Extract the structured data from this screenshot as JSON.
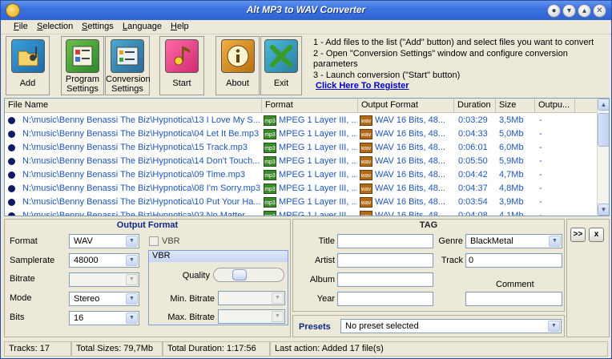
{
  "window": {
    "title": "Alt MP3 to WAV Converter"
  },
  "menu": [
    {
      "label": "File",
      "u": "F",
      "rest": "ile"
    },
    {
      "label": "Selection",
      "u": "S",
      "rest": "election"
    },
    {
      "label": "Settings",
      "u": "S",
      "rest": "ettings"
    },
    {
      "label": "Language",
      "u": "L",
      "rest": "anguage"
    },
    {
      "label": "Help",
      "u": "H",
      "rest": "elp"
    }
  ],
  "toolbar": {
    "add": "Add",
    "program_settings_1": "Program",
    "program_settings_2": "Settings",
    "conversion_settings_1": "Conversion",
    "conversion_settings_2": "Settings",
    "start": "Start",
    "about": "About",
    "exit": "Exit"
  },
  "instructions": {
    "line1": "1 - Add files to the list (\"Add\" button) and select files you want to convert",
    "line2": "2 - Open \"Conversion Settings\" window and configure conversion parameters",
    "line3": "3 - Launch conversion (\"Start\" button)",
    "register": "Click Here To Register"
  },
  "filelist": {
    "columns": [
      "File Name",
      "Format",
      "Output Format",
      "Duration",
      "Size",
      "Outpu..."
    ],
    "rows": [
      {
        "name": "N:\\music\\Benny Benassi The Biz\\Hypnotica\\13 I Love My S...",
        "format": "MPEG 1 Layer III, ...",
        "output": "WAV 16 Bits, 48...",
        "duration": "0:03:29",
        "size": "3,5Mb",
        "out": "-"
      },
      {
        "name": "N:\\music\\Benny Benassi The Biz\\Hypnotica\\04 Let It Be.mp3",
        "format": "MPEG 1 Layer III, ...",
        "output": "WAV 16 Bits, 48...",
        "duration": "0:04:33",
        "size": "5,0Mb",
        "out": "-"
      },
      {
        "name": "N:\\music\\Benny Benassi The Biz\\Hypnotica\\15 Track.mp3",
        "format": "MPEG 1 Layer III, ...",
        "output": "WAV 16 Bits, 48...",
        "duration": "0:06:01",
        "size": "6,0Mb",
        "out": "-"
      },
      {
        "name": "N:\\music\\Benny Benassi The Biz\\Hypnotica\\14 Don't Touch...",
        "format": "MPEG 1 Layer III, ...",
        "output": "WAV 16 Bits, 48...",
        "duration": "0:05:50",
        "size": "5,9Mb",
        "out": "-"
      },
      {
        "name": "N:\\music\\Benny Benassi The Biz\\Hypnotica\\09 Time.mp3",
        "format": "MPEG 1 Layer III, ...",
        "output": "WAV 16 Bits, 48...",
        "duration": "0:04:42",
        "size": "4,7Mb",
        "out": "-"
      },
      {
        "name": "N:\\music\\Benny Benassi The Biz\\Hypnotica\\08 I'm Sorry.mp3",
        "format": "MPEG 1 Layer III, ...",
        "output": "WAV 16 Bits, 48...",
        "duration": "0:04:37",
        "size": "4,8Mb",
        "out": "-"
      },
      {
        "name": "N:\\music\\Benny Benassi The Biz\\Hypnotica\\10 Put Your Ha...",
        "format": "MPEG 1 Layer III, ...",
        "output": "WAV 16 Bits, 48...",
        "duration": "0:03:54",
        "size": "3,9Mb",
        "out": "-"
      },
      {
        "name": "N:\\music\\Benny Benassi The Biz\\Hypnotica\\03 No Matter...",
        "format": "MPEG 1 Layer III, ...",
        "output": "WAV 16 Bits, 48...",
        "duration": "0:04:08",
        "size": "4,1Mb",
        "out": "-"
      }
    ],
    "format_icon": "mp3",
    "output_icon": "wav"
  },
  "output_format": {
    "header": "Output Format",
    "format_label": "Format",
    "format_value": "WAV",
    "samplerate_label": "Samplerate",
    "samplerate_value": "48000",
    "bitrate_label": "Bitrate",
    "bitrate_value": "",
    "mode_label": "Mode",
    "mode_value": "Stereo",
    "bits_label": "Bits",
    "bits_value": "16",
    "vbr_checkbox_label": "VBR",
    "vbr_group_label": "VBR",
    "quality_label": "Quality",
    "quality_level": 0.33,
    "min_bitrate_label": "Min. Bitrate",
    "max_bitrate_label": "Max. Bitrate"
  },
  "tag": {
    "header": "TAG",
    "title_label": "Title",
    "title_value": "",
    "artist_label": "Artist",
    "artist_value": "",
    "album_label": "Album",
    "album_value": "",
    "year_label": "Year",
    "year_value": "",
    "genre_label": "Genre",
    "genre_value": "BlackMetal",
    "track_label": "Track",
    "track_value": "0",
    "comment_label": "Comment",
    "comment_value": ""
  },
  "presets": {
    "label": "Presets",
    "value": "No preset selected"
  },
  "side_buttons": {
    "next": ">>",
    "clear": "x"
  },
  "status": {
    "tracks": "Tracks: 17",
    "total_size": "Total Sizes: 79,7Mb",
    "total_duration": "Total Duration: 1:17:56",
    "last_action": "Last action: Added 17 file(s)"
  }
}
